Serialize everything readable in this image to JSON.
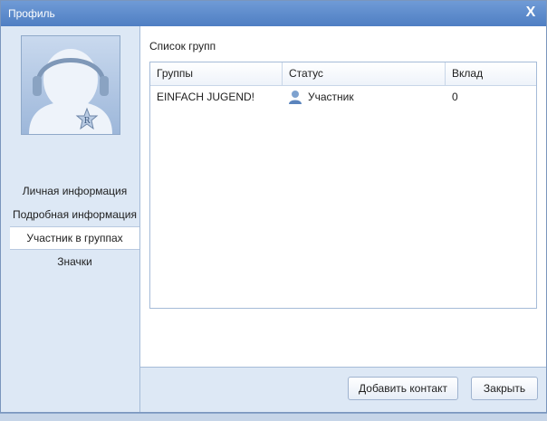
{
  "window": {
    "title": "Профиль",
    "close_glyph": "X"
  },
  "sidebar": {
    "avatar_badge": "R",
    "items": [
      {
        "label": "Личная информация"
      },
      {
        "label": "Подробная информация"
      },
      {
        "label": "Участник в группах"
      },
      {
        "label": "Значки"
      }
    ],
    "active_index": 2
  },
  "main": {
    "section_label": "Список групп",
    "columns": [
      "Группы",
      "Статус",
      "Вклад"
    ],
    "rows": [
      {
        "group": "EINFACH JUGEND!",
        "status": "Участник",
        "status_icon": "user-icon",
        "contribution": "0"
      }
    ]
  },
  "footer": {
    "add_contact_label": "Добавить контакт",
    "close_label": "Закрыть"
  },
  "colors": {
    "titlebar": "#5a88c9",
    "panel": "#dde8f5",
    "border": "#a5bbd8"
  }
}
